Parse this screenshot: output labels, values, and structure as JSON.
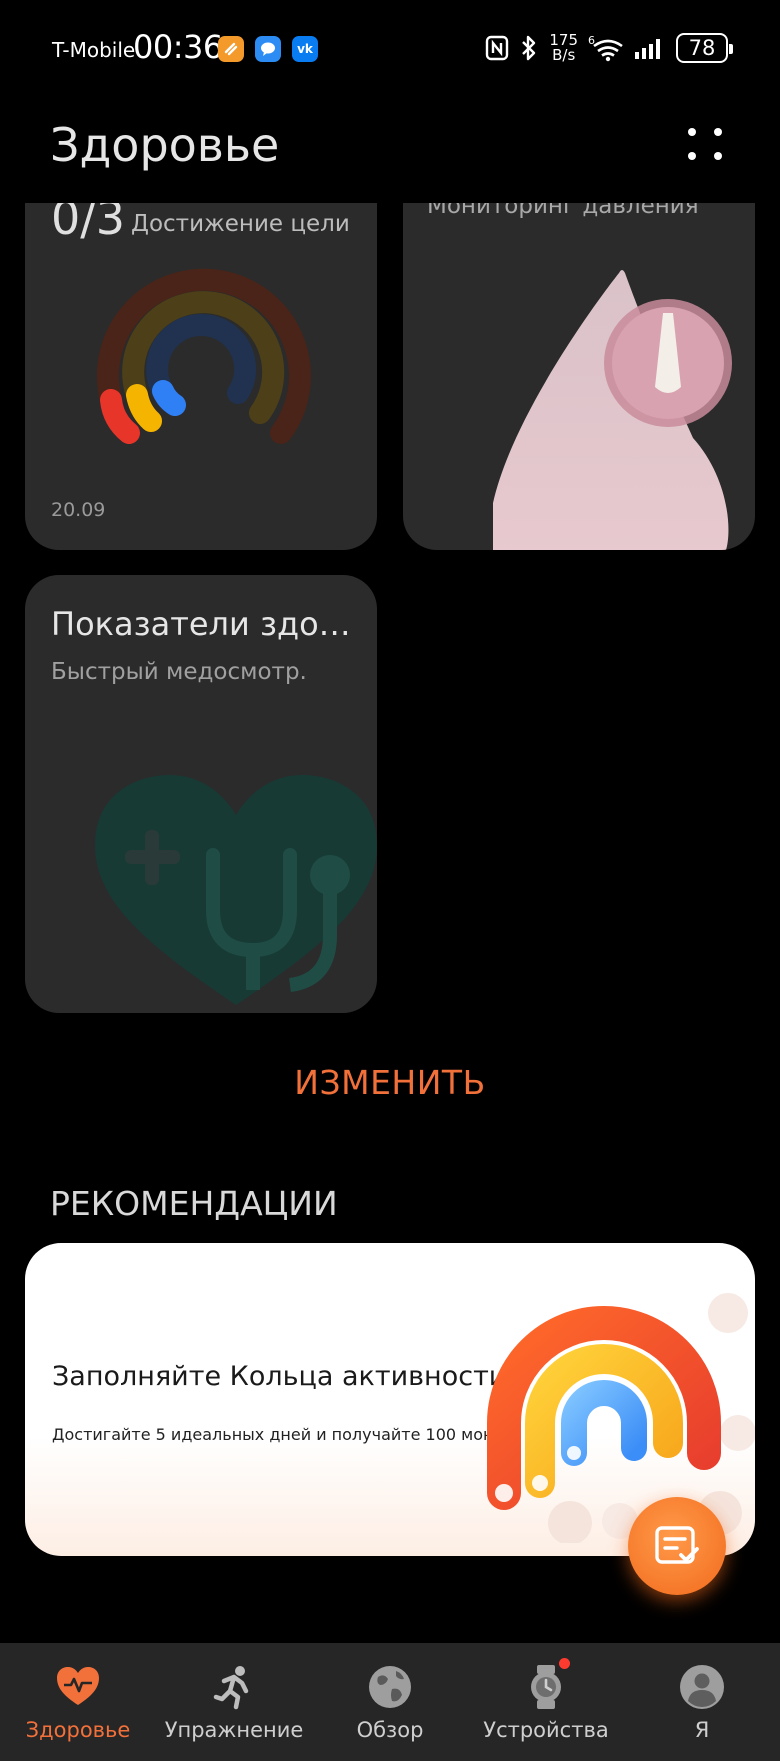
{
  "status_bar": {
    "carrier": "T-Mobile",
    "time": "00:36",
    "net_speed_value": "175",
    "net_speed_unit": "B/s",
    "battery": "78",
    "icons": [
      "app-orange-icon",
      "message-bubble-icon",
      "vk-icon",
      "nfc-icon",
      "bluetooth-icon",
      "wifi-6-icon",
      "signal-icon",
      "battery-icon"
    ]
  },
  "header": {
    "title": "Здоровье",
    "more_icon": "more-dots-icon"
  },
  "cards": {
    "goal": {
      "count": "0/3",
      "label": "Достижение цели",
      "date": "20.09",
      "rings": [
        {
          "name": "outer",
          "color": "#e8352a",
          "progress": 0.06
        },
        {
          "name": "middle",
          "color": "#f5b400",
          "progress": 0.06
        },
        {
          "name": "inner",
          "color": "#2f7ff5",
          "progress": 0.06
        }
      ]
    },
    "blood_pressure": {
      "title": "Мониторинг давления",
      "icon": "blood-drop-gauge-icon"
    },
    "health_indicators": {
      "title": "Показатели здо…",
      "subtitle": "Быстрый медосмотр.",
      "icon": "heart-stethoscope-icon"
    }
  },
  "edit_label": "ИЗМЕНИТЬ",
  "recommendations": {
    "section_title": "РЕКОМЕНДАЦИИ",
    "card": {
      "title": "Заполняйте Кольца активности",
      "text": "Достигайте 5 идеальных дней и получайте 100 монет",
      "icon": "activity-rings-icon"
    }
  },
  "fab": {
    "icon": "checklist-icon"
  },
  "bottom_nav": {
    "items": [
      {
        "label": "Здоровье",
        "icon": "heart-pulse-icon",
        "active": true
      },
      {
        "label": "Упражнение",
        "icon": "running-icon",
        "active": false
      },
      {
        "label": "Обзор",
        "icon": "globe-icon",
        "active": false
      },
      {
        "label": "Устройства",
        "icon": "watch-icon",
        "active": false,
        "badge": true
      },
      {
        "label": "Я",
        "icon": "profile-icon",
        "active": false
      }
    ]
  },
  "colors": {
    "accent": "#f2703a",
    "background": "#000000",
    "card": "#2b2b2b",
    "nav": "#262626"
  }
}
